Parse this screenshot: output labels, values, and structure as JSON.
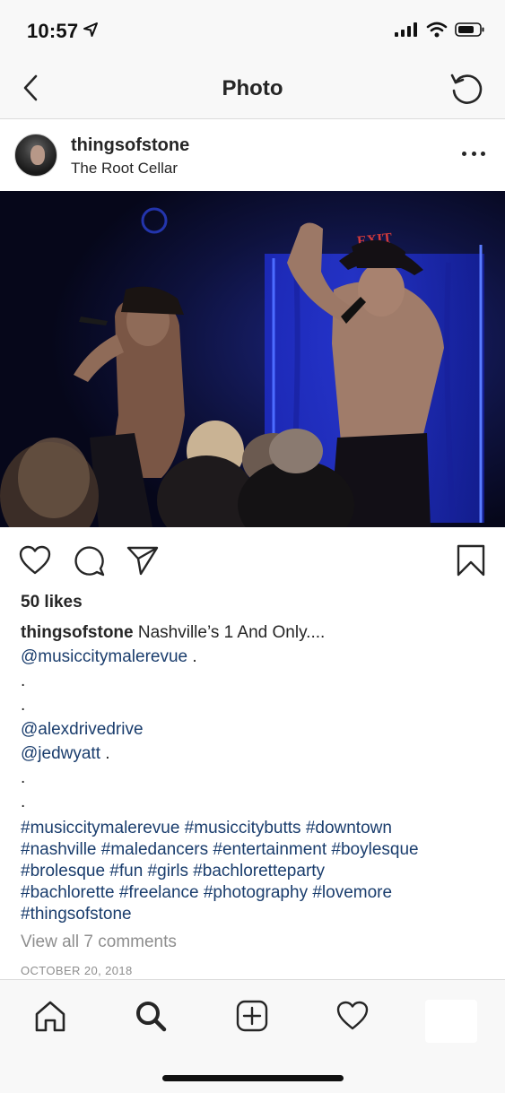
{
  "status_bar": {
    "time": "10:57",
    "icons": [
      "location-arrow-icon",
      "signal-icon",
      "wifi-icon",
      "battery-icon"
    ]
  },
  "nav": {
    "title": "Photo",
    "back_icon": "chevron-left-icon",
    "refresh_icon": "refresh-icon"
  },
  "post": {
    "username": "thingsofstone",
    "location": "The Root Cellar",
    "photo": {
      "exit_sign": "EXIT",
      "colors": {
        "stage_light": "#2430c8",
        "background": "#0b0c26"
      }
    },
    "likes": "50 likes",
    "caption": {
      "user": "thingsofstone",
      "text": " Nashville’s 1 And Only....",
      "mention_1": "@musiccitymalerevue",
      "mention_1_suffix": " .",
      "dot_1": ".",
      "dot_2": ".",
      "mention_2": "@alexdrivedrive",
      "mention_3": "@jedwyatt",
      "mention_3_suffix": " .",
      "dot_3": ".",
      "dot_4": ".",
      "hashtag_lines": [
        "#musiccitymalerevue #musiccitybutts #downtown",
        "#nashville #maledancers #entertainment #boylesque",
        "#brolesque #fun #girls #bachloretteparty",
        "#bachlorette #freelance #photography #lovemore",
        "#thingsofstone"
      ]
    },
    "view_comments": "View all 7 comments",
    "date": "OCTOBER 20, 2018"
  },
  "action_icons": [
    "heart-icon",
    "comment-icon",
    "send-icon",
    "bookmark-icon"
  ],
  "tab_bar": [
    "home-icon",
    "search-icon",
    "add-post-icon",
    "activity-heart-icon",
    "profile-tab"
  ],
  "colors": {
    "link": "#1a3d6d",
    "text": "#262626",
    "muted": "#8e8e8e",
    "bar_bg": "#f8f8f8"
  }
}
